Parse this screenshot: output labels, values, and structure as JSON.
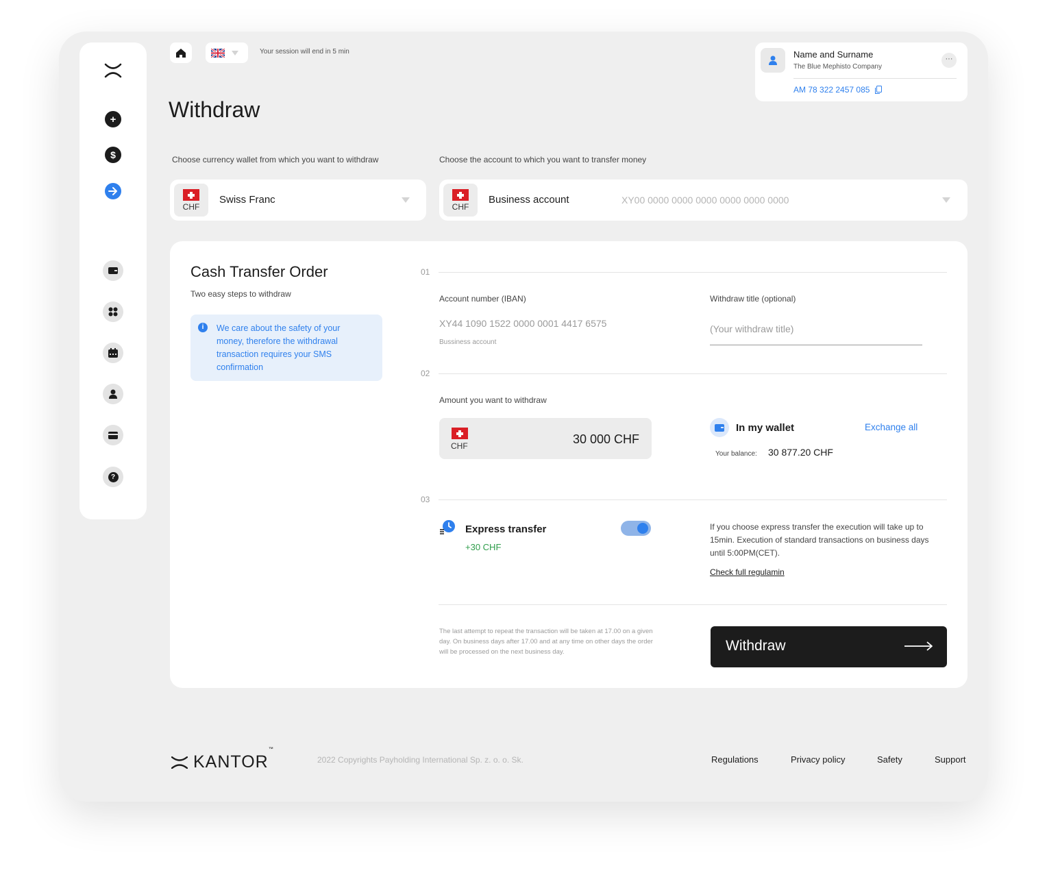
{
  "topbar": {
    "session_text": "Your session will end in 5 min"
  },
  "user": {
    "name": "Name and Surname",
    "company": "The Blue Mephisto Company",
    "account": "AM 78 322 2457 085",
    "more_label": "···"
  },
  "page": {
    "title": "Withdraw"
  },
  "source": {
    "label": "Choose currency wallet from which you want to withdraw",
    "currency_code": "CHF",
    "currency_name": "Swiss Franc"
  },
  "target": {
    "label": "Choose the account to which you want to transfer money",
    "currency_code": "CHF",
    "account_name": "Business account",
    "iban_placeholder": "XY00 0000 0000 0000 0000 0000 0000"
  },
  "order": {
    "title": "Cash Transfer Order",
    "subtitle": "Two easy steps to withdraw",
    "info_icon": "i",
    "info_text": "We care about the safety of your money, therefore the withdrawal transaction requires your SMS confirmation",
    "steps": [
      "01",
      "02",
      "03"
    ],
    "iban_label": "Account number (IBAN)",
    "iban_value": "XY44 1090 1522 0000 0001 4417 6575",
    "iban_sub": "Bussiness account",
    "withdraw_title_label": "Withdraw title (optional)",
    "withdraw_title_placeholder": "(Your withdraw title)",
    "amount_label": "Amount you want to withdraw",
    "amount_currency": "CHF",
    "amount_value": "30 000 CHF",
    "wallet_label": "In my wallet",
    "exchange_all": "Exchange all",
    "balance_label": "Your balance:",
    "balance_value": "30 877.20 CHF",
    "express_label": "Express transfer",
    "express_fee": "+30 CHF",
    "express_enabled": true,
    "express_desc": "If you choose express transfer the execution will take up to 15min. Execution of standard transactions on business days until 5:00PM(CET).",
    "regulamin": "Check full regulamin",
    "footnote": "The last attempt to repeat the transaction will be taken at 17.00 on a given day. On business days after 17.00 and at any time on other days the order will be processed on the next business day.",
    "submit_label": "Withdraw"
  },
  "footer": {
    "brand": "KANTOR",
    "tm": "™",
    "copyright": "2022 Copyrights Payholding International Sp. z. o. o. Sk.",
    "links": [
      "Regulations",
      "Privacy policy",
      "Safety",
      "Support"
    ]
  },
  "colors": {
    "accent": "#2f80ed",
    "success": "#2e9d4a",
    "dark": "#1c1c1c",
    "background": "#efefef"
  },
  "icons": {
    "sidebar": [
      "logo-x-icon",
      "add-icon",
      "dollar-icon",
      "arrow-right-icon",
      "wallet-icon",
      "dashboard-icon",
      "calendar-icon",
      "user-icon",
      "card-icon",
      "help-icon"
    ],
    "topbar": [
      "home-icon",
      "uk-flag-icon",
      "chevron-down-icon"
    ]
  }
}
